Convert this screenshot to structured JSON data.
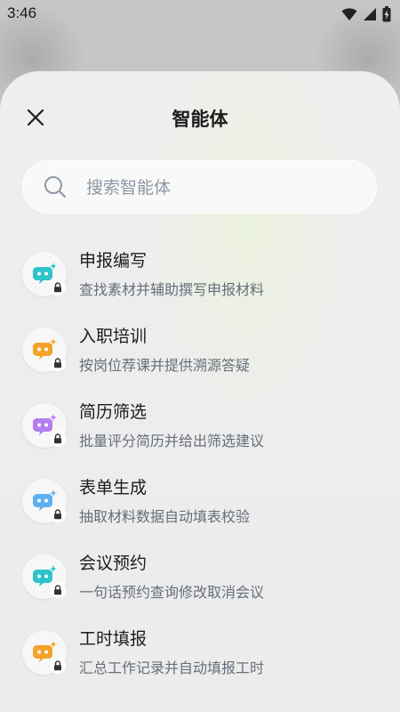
{
  "status_bar": {
    "time": "3:46",
    "icons": [
      "wifi-icon",
      "signal-icon",
      "battery-charging-icon"
    ]
  },
  "sheet": {
    "title": "智能体",
    "close_icon": "close-icon"
  },
  "search": {
    "placeholder": "搜索智能体",
    "value": "",
    "icon": "search-icon"
  },
  "agents": [
    {
      "title": "申报编写",
      "description": "查找素材并辅助撰写申报材料",
      "color": "#2ec4c9",
      "icon": "robot-icon",
      "locked": true
    },
    {
      "title": "入职培训",
      "description": "按岗位荐课并提供溯源答疑",
      "color": "#f4a32a",
      "icon": "robot-icon",
      "locked": true
    },
    {
      "title": "简历筛选",
      "description": "批量评分简历并给出筛选建议",
      "color": "#b47ef0",
      "icon": "robot-icon",
      "locked": true
    },
    {
      "title": "表单生成",
      "description": "抽取材料数据自动填表校验",
      "color": "#5fb0f0",
      "icon": "robot-icon",
      "locked": true
    },
    {
      "title": "会议预约",
      "description": "一句话预约查询修改取消会议",
      "color": "#2ec4c9",
      "icon": "robot-icon",
      "locked": true
    },
    {
      "title": "工时填报",
      "description": "汇总工作记录并自动填报工时",
      "color": "#f4a32a",
      "icon": "robot-icon",
      "locked": true
    }
  ]
}
